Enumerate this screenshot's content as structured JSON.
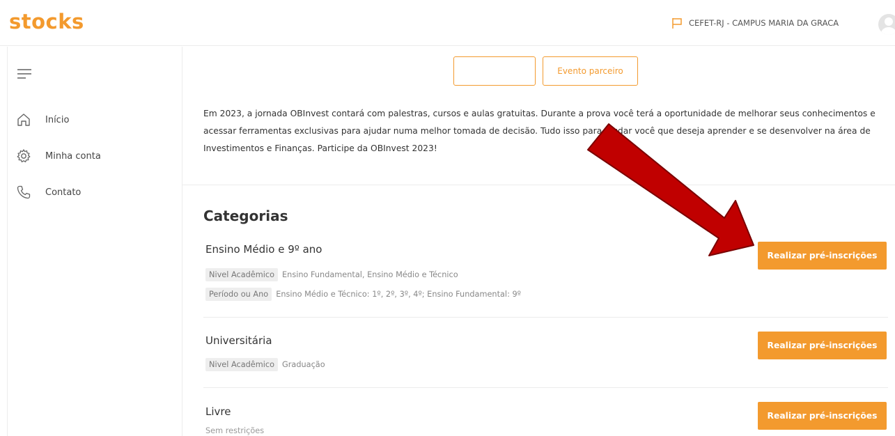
{
  "header": {
    "brand": "stocks",
    "institution": "CEFET-RJ - CAMPUS MARIA DA GRACA",
    "accent": "#f39a2e"
  },
  "sidebar": {
    "items": [
      {
        "label": "Início",
        "icon": "home-icon"
      },
      {
        "label": "Minha conta",
        "icon": "gear-icon"
      },
      {
        "label": "Contato",
        "icon": "phone-icon"
      }
    ]
  },
  "main": {
    "tabs": [
      {
        "label": ""
      },
      {
        "label": "Evento parceiro"
      }
    ],
    "intro": "Em 2023, a jornada OBInvest contará com palestras, cursos e aulas gratuitas. Durante a prova você terá a oportunidade de melhorar seus conhecimentos e acessar ferramentas exclusivas para ajudar numa melhor tomada de decisão. Tudo isso para ajudar você que deseja aprender e se desenvolver na área de Investimentos e Finanças. Participe da OBInvest 2023!",
    "categories_title": "Categorias",
    "categories": [
      {
        "name": "Ensino Médio e 9º ano",
        "tags": [
          {
            "label": "Nivel Acadêmico",
            "value": "Ensino Fundamental, Ensino Médio e Técnico"
          },
          {
            "label": "Período ou Ano",
            "value": "Ensino Médio e Técnico: 1º, 2º, 3º, 4º; Ensino Fundamental: 9º"
          }
        ],
        "button": "Realizar pré-inscrições"
      },
      {
        "name": "Universitária",
        "tags": [
          {
            "label": "Nivel Acadêmico",
            "value": "Graduação"
          }
        ],
        "button": "Realizar pré-inscrições"
      },
      {
        "name": "Livre",
        "restriction": "Sem restrições",
        "button": "Realizar pré-inscrições"
      }
    ]
  },
  "annotation": {
    "arrow_color": "#c00000"
  }
}
